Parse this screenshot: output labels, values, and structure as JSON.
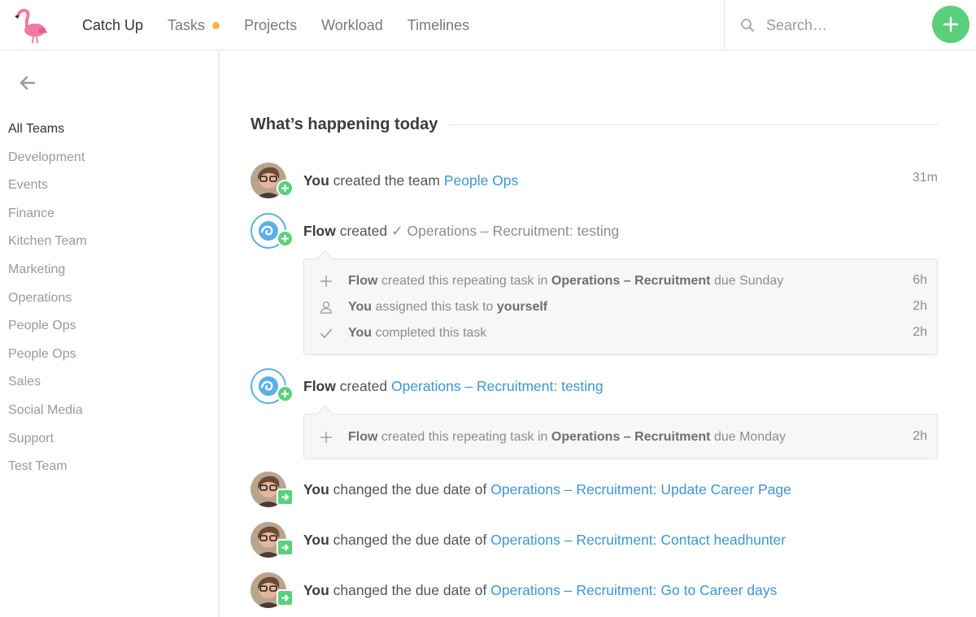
{
  "nav": {
    "items": [
      {
        "label": "Catch Up",
        "active": true
      },
      {
        "label": "Tasks",
        "has_dot": true
      },
      {
        "label": "Projects"
      },
      {
        "label": "Workload"
      },
      {
        "label": "Timelines"
      }
    ],
    "dot_color": "#f6b24a"
  },
  "search": {
    "placeholder": "Search…",
    "icon": "search-icon"
  },
  "add_button": {
    "icon": "plus-icon",
    "color": "#5bd07c"
  },
  "sidebar": {
    "back_icon": "arrow-left-icon",
    "teams": [
      "All Teams",
      "Development",
      "Events",
      "Finance",
      "Kitchen Team",
      "Marketing",
      "Operations",
      "People Ops",
      "People Ops",
      "Sales",
      "Social Media",
      "Support",
      "Test Team"
    ],
    "active_team": "All Teams"
  },
  "main": {
    "section_title": "What’s happening today",
    "events": [
      {
        "actor": "You",
        "verb": " created the team ",
        "link": "People Ops",
        "time": "31m"
      },
      {
        "actor": "Flow",
        "verb": " created ",
        "check": "✓",
        "muted": " Operations – Recruitment: testing",
        "details": [
          {
            "icon": "plus-icon",
            "actor": "Flow",
            "text1": " created this repeating task in ",
            "bold": "Operations – Recruitment",
            "text2": " due Sunday",
            "time": "6h"
          },
          {
            "icon": "user-icon",
            "actor": "You",
            "text1": " assigned this task to ",
            "bold": "yourself",
            "text2": "",
            "time": "2h"
          },
          {
            "icon": "check-icon",
            "actor": "You",
            "text1": " completed this task",
            "bold": "",
            "text2": "",
            "time": "2h"
          }
        ]
      },
      {
        "actor": "Flow",
        "verb": " created ",
        "link": "Operations – Recruitment: testing",
        "details": [
          {
            "icon": "plus-icon",
            "actor": "Flow",
            "text1": " created this repeating task in ",
            "bold": "Operations – Recruitment",
            "text2": " due Monday",
            "time": "2h"
          }
        ]
      },
      {
        "actor": "You",
        "verb": " changed the due date of ",
        "link": "Operations – Recruitment: Update Career Page"
      },
      {
        "actor": "You",
        "verb": " changed the due date of ",
        "link": "Operations – Recruitment: Contact headhunter"
      },
      {
        "actor": "You",
        "verb": " changed the due date of ",
        "link": "Operations – Recruitment: Go to Career days"
      }
    ]
  },
  "colors": {
    "link": "#3d96d4",
    "accent_green": "#5bd07c",
    "flow_blue": "#5bb0e6"
  }
}
